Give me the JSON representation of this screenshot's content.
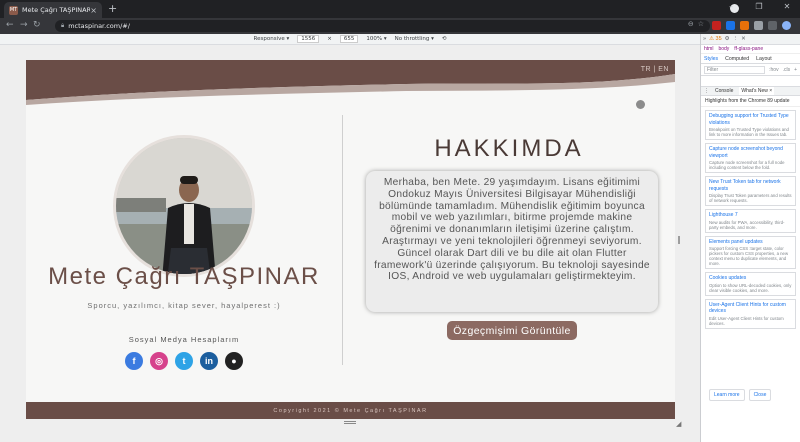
{
  "browser": {
    "tab_title": "Mete Çağrı TAŞPINAR",
    "tab_favicon": "MT",
    "url": "mctaspinar.com/#/"
  },
  "device_toolbar": {
    "mode": "Responsive ▾",
    "width": "1556",
    "height": "655",
    "zoom": "100% ▾",
    "throttle": "No throttling ▾"
  },
  "site": {
    "lang_tr": "TR",
    "lang_sep": "|",
    "lang_en": "EN",
    "name": "Mete Çağrı TAŞPINAR",
    "tagline": "Sporcu, yazılımcı, kitap sever, hayalperest :)",
    "social_title": "Sosyal Medya Hesaplarım",
    "social": [
      {
        "icon": "facebook-icon",
        "glyph": "f",
        "color": "#3b7be0"
      },
      {
        "icon": "instagram-icon",
        "glyph": "◎",
        "color": "#d6428c"
      },
      {
        "icon": "twitter-icon",
        "glyph": "t",
        "color": "#2ea3e6"
      },
      {
        "icon": "linkedin-icon",
        "glyph": "in",
        "color": "#1b5e9e"
      },
      {
        "icon": "github-icon",
        "glyph": "●",
        "color": "#222222"
      }
    ],
    "about_title": "HAKKIMDA",
    "about_text": "Merhaba, ben Mete. 29 yaşımdayım. Lisans eğitimimi Ondokuz Mayıs Üniversitesi Bilgisayar Mühendisliği bölümünde tamamladım. Mühendislik eğitimim boyunca mobil ve web yazılımları, bitirme projemde makine öğrenimi ve donanımların iletişimi üzerine çalıştım. Araştırmayı ve yeni teknolojileri öğrenmeyi seviyorum. Güncel olarak Dart dili ve bu dile ait olan Flutter framework'ü üzerinde çalışıyorum. Bu teknoloji sayesinde IOS, Android ve web uygulamaları geliştirmekteyim.",
    "cv_button": "Özgeçmişimi Görüntüle",
    "footer": "Copyright 2021 © Mete Çağrı TAŞPINAR",
    "colors": {
      "brand": "#6a4d47",
      "button": "#8c6a62"
    }
  },
  "devtools": {
    "top_badge": "⚠ 35",
    "crumbs": [
      "html",
      "body",
      "ff-glass-pane"
    ],
    "tabs": [
      "Styles",
      "Computed",
      "Layout"
    ],
    "filter_placeholder": "Filter",
    "filter_hov": ":hov",
    "filter_cls": ".cls",
    "filter_plus": "+",
    "drawer_tabs": [
      "Console",
      "What's New ×"
    ],
    "highlight": "Highlights from the Chrome 89 update",
    "cards": [
      {
        "title": "Debugging support for Trusted Type violations",
        "desc": "Breakpoint on Trusted Type violations and link to more information in the Issues tab."
      },
      {
        "title": "Capture node screenshot beyond viewport",
        "desc": "Capture node screenshot for a full node including content below the fold."
      },
      {
        "title": "New Trust Token tab for network requests",
        "desc": "Display Trust Token parameters and results of network requests."
      },
      {
        "title": "Lighthouse 7",
        "desc": "New audits for PWA, accessibility, third-party embeds, and more."
      },
      {
        "title": "Elements panel updates",
        "desc": "Support forcing CSS :target state, color pickers for custom CSS properties, a new context menu to duplicate elements, and more."
      },
      {
        "title": "Cookies updates",
        "desc": "Option to show URL-decoded cookies, only clear visible cookies, and more."
      },
      {
        "title": "User-Agent Client Hints for custom devices",
        "desc": "Edit User-Agent Client Hints for custom devices."
      }
    ],
    "learn_more": "Learn more",
    "close": "Close"
  }
}
